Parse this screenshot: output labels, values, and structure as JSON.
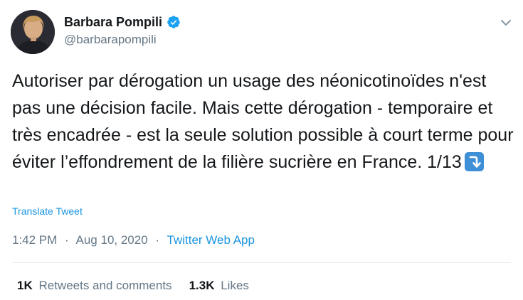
{
  "author": {
    "name": "Barbara Pompili",
    "handle": "@barbarapompili",
    "verified": true
  },
  "tweet": {
    "text": "Autoriser par dérogation un usage des néonicotinoïdes n'est pas une décision facile. Mais cette dérogation - temporaire et très encadrée - est la seule solution possible à court terme pour éviter l’effondrement de la filière sucrière en France. 1/13",
    "emoji_icon": "arrow-curve-down-icon",
    "translate_label": "Translate Tweet",
    "time": "1:42 PM",
    "date": "Aug 10, 2020",
    "separator": "·",
    "source": "Twitter Web App"
  },
  "stats": {
    "retweets_count": "1K",
    "retweets_label": "Retweets and comments",
    "likes_count": "1.3K",
    "likes_label": "Likes"
  },
  "colors": {
    "link": "#1b95e0",
    "secondary_text": "#657786",
    "verified": "#1da1f2"
  }
}
